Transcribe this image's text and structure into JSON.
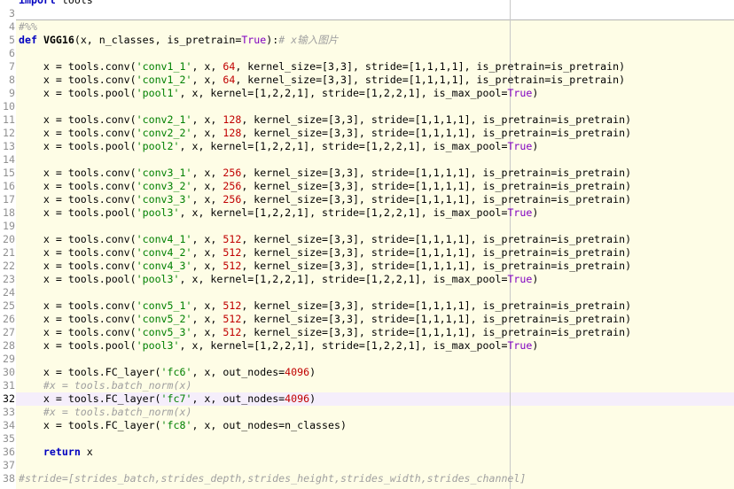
{
  "editor": {
    "current_line": "32",
    "lines": [
      {
        "n": "",
        "segments": [
          {
            "t": "import",
            "c": "kw"
          },
          {
            "t": " tools",
            "c": ""
          }
        ]
      },
      {
        "n": "3",
        "segments": []
      },
      {
        "n": "4",
        "segments": [
          {
            "t": "#%%",
            "c": "cmt"
          }
        ]
      },
      {
        "n": "5",
        "segments": [
          {
            "t": "def",
            "c": "kw"
          },
          {
            "t": " ",
            "c": ""
          },
          {
            "t": "VGG16",
            "c": "fn"
          },
          {
            "t": "(x, n_classes, is_pretrain=",
            "c": ""
          },
          {
            "t": "True",
            "c": "const"
          },
          {
            "t": "):",
            "c": ""
          },
          {
            "t": "# x输入图片",
            "c": "cmt"
          }
        ]
      },
      {
        "n": "6",
        "segments": []
      },
      {
        "n": "7",
        "segments": [
          {
            "t": "    x = tools.conv(",
            "c": ""
          },
          {
            "t": "'conv1_1'",
            "c": "str"
          },
          {
            "t": ", x, ",
            "c": ""
          },
          {
            "t": "64",
            "c": "num"
          },
          {
            "t": ", kernel_size=[3,3], stride=[1,1,1,1], is_pretrain=is_pretrain)",
            "c": ""
          }
        ]
      },
      {
        "n": "8",
        "segments": [
          {
            "t": "    x = tools.conv(",
            "c": ""
          },
          {
            "t": "'conv1_2'",
            "c": "str"
          },
          {
            "t": ", x, ",
            "c": ""
          },
          {
            "t": "64",
            "c": "num"
          },
          {
            "t": ", kernel_size=[3,3], stride=[1,1,1,1], is_pretrain=is_pretrain)",
            "c": ""
          }
        ]
      },
      {
        "n": "9",
        "segments": [
          {
            "t": "    x = tools.pool(",
            "c": ""
          },
          {
            "t": "'pool1'",
            "c": "str"
          },
          {
            "t": ", x, kernel=[1,2,2,1], stride=[1,2,2,1], is_max_pool=",
            "c": ""
          },
          {
            "t": "True",
            "c": "const"
          },
          {
            "t": ")",
            "c": ""
          }
        ]
      },
      {
        "n": "10",
        "segments": []
      },
      {
        "n": "11",
        "segments": [
          {
            "t": "    x = tools.conv(",
            "c": ""
          },
          {
            "t": "'conv2_1'",
            "c": "str"
          },
          {
            "t": ", x, ",
            "c": ""
          },
          {
            "t": "128",
            "c": "num"
          },
          {
            "t": ", kernel_size=[3,3], stride=[1,1,1,1], is_pretrain=is_pretrain)",
            "c": ""
          }
        ]
      },
      {
        "n": "12",
        "segments": [
          {
            "t": "    x = tools.conv(",
            "c": ""
          },
          {
            "t": "'conv2_2'",
            "c": "str"
          },
          {
            "t": ", x, ",
            "c": ""
          },
          {
            "t": "128",
            "c": "num"
          },
          {
            "t": ", kernel_size=[3,3], stride=[1,1,1,1], is_pretrain=is_pretrain)",
            "c": ""
          }
        ]
      },
      {
        "n": "13",
        "segments": [
          {
            "t": "    x = tools.pool(",
            "c": ""
          },
          {
            "t": "'pool2'",
            "c": "str"
          },
          {
            "t": ", x, kernel=[1,2,2,1], stride=[1,2,2,1], is_max_pool=",
            "c": ""
          },
          {
            "t": "True",
            "c": "const"
          },
          {
            "t": ")",
            "c": ""
          }
        ]
      },
      {
        "n": "14",
        "segments": []
      },
      {
        "n": "15",
        "segments": [
          {
            "t": "    x = tools.conv(",
            "c": ""
          },
          {
            "t": "'conv3_1'",
            "c": "str"
          },
          {
            "t": ", x, ",
            "c": ""
          },
          {
            "t": "256",
            "c": "num"
          },
          {
            "t": ", kernel_size=[3,3], stride=[1,1,1,1], is_pretrain=is_pretrain)",
            "c": ""
          }
        ]
      },
      {
        "n": "16",
        "segments": [
          {
            "t": "    x = tools.conv(",
            "c": ""
          },
          {
            "t": "'conv3_2'",
            "c": "str"
          },
          {
            "t": ", x, ",
            "c": ""
          },
          {
            "t": "256",
            "c": "num"
          },
          {
            "t": ", kernel_size=[3,3], stride=[1,1,1,1], is_pretrain=is_pretrain)",
            "c": ""
          }
        ]
      },
      {
        "n": "17",
        "segments": [
          {
            "t": "    x = tools.conv(",
            "c": ""
          },
          {
            "t": "'conv3_3'",
            "c": "str"
          },
          {
            "t": ", x, ",
            "c": ""
          },
          {
            "t": "256",
            "c": "num"
          },
          {
            "t": ", kernel_size=[3,3], stride=[1,1,1,1], is_pretrain=is_pretrain)",
            "c": ""
          }
        ]
      },
      {
        "n": "18",
        "segments": [
          {
            "t": "    x = tools.pool(",
            "c": ""
          },
          {
            "t": "'pool3'",
            "c": "str"
          },
          {
            "t": ", x, kernel=[1,2,2,1], stride=[1,2,2,1], is_max_pool=",
            "c": ""
          },
          {
            "t": "True",
            "c": "const"
          },
          {
            "t": ")",
            "c": ""
          }
        ]
      },
      {
        "n": "19",
        "segments": []
      },
      {
        "n": "20",
        "segments": [
          {
            "t": "    x = tools.conv(",
            "c": ""
          },
          {
            "t": "'conv4_1'",
            "c": "str"
          },
          {
            "t": ", x, ",
            "c": ""
          },
          {
            "t": "512",
            "c": "num"
          },
          {
            "t": ", kernel_size=[3,3], stride=[1,1,1,1], is_pretrain=is_pretrain)",
            "c": ""
          }
        ]
      },
      {
        "n": "21",
        "segments": [
          {
            "t": "    x = tools.conv(",
            "c": ""
          },
          {
            "t": "'conv4_2'",
            "c": "str"
          },
          {
            "t": ", x, ",
            "c": ""
          },
          {
            "t": "512",
            "c": "num"
          },
          {
            "t": ", kernel_size=[3,3], stride=[1,1,1,1], is_pretrain=is_pretrain)",
            "c": ""
          }
        ]
      },
      {
        "n": "22",
        "segments": [
          {
            "t": "    x = tools.conv(",
            "c": ""
          },
          {
            "t": "'conv4_3'",
            "c": "str"
          },
          {
            "t": ", x, ",
            "c": ""
          },
          {
            "t": "512",
            "c": "num"
          },
          {
            "t": ", kernel_size=[3,3], stride=[1,1,1,1], is_pretrain=is_pretrain)",
            "c": ""
          }
        ]
      },
      {
        "n": "23",
        "segments": [
          {
            "t": "    x = tools.pool(",
            "c": ""
          },
          {
            "t": "'pool3'",
            "c": "str"
          },
          {
            "t": ", x, kernel=[1,2,2,1], stride=[1,2,2,1], is_max_pool=",
            "c": ""
          },
          {
            "t": "True",
            "c": "const"
          },
          {
            "t": ")",
            "c": ""
          }
        ]
      },
      {
        "n": "24",
        "segments": []
      },
      {
        "n": "25",
        "segments": [
          {
            "t": "    x = tools.conv(",
            "c": ""
          },
          {
            "t": "'conv5_1'",
            "c": "str"
          },
          {
            "t": ", x, ",
            "c": ""
          },
          {
            "t": "512",
            "c": "num"
          },
          {
            "t": ", kernel_size=[3,3], stride=[1,1,1,1], is_pretrain=is_pretrain)",
            "c": ""
          }
        ]
      },
      {
        "n": "26",
        "segments": [
          {
            "t": "    x = tools.conv(",
            "c": ""
          },
          {
            "t": "'conv5_2'",
            "c": "str"
          },
          {
            "t": ", x, ",
            "c": ""
          },
          {
            "t": "512",
            "c": "num"
          },
          {
            "t": ", kernel_size=[3,3], stride=[1,1,1,1], is_pretrain=is_pretrain)",
            "c": ""
          }
        ]
      },
      {
        "n": "27",
        "segments": [
          {
            "t": "    x = tools.conv(",
            "c": ""
          },
          {
            "t": "'conv5_3'",
            "c": "str"
          },
          {
            "t": ", x, ",
            "c": ""
          },
          {
            "t": "512",
            "c": "num"
          },
          {
            "t": ", kernel_size=[3,3], stride=[1,1,1,1], is_pretrain=is_pretrain)",
            "c": ""
          }
        ]
      },
      {
        "n": "28",
        "segments": [
          {
            "t": "    x = tools.pool(",
            "c": ""
          },
          {
            "t": "'pool3'",
            "c": "str"
          },
          {
            "t": ", x, kernel=[1,2,2,1], stride=[1,2,2,1], is_max_pool=",
            "c": ""
          },
          {
            "t": "True",
            "c": "const"
          },
          {
            "t": ")",
            "c": ""
          }
        ]
      },
      {
        "n": "29",
        "segments": []
      },
      {
        "n": "30",
        "segments": [
          {
            "t": "    x = tools.FC_layer(",
            "c": ""
          },
          {
            "t": "'fc6'",
            "c": "str"
          },
          {
            "t": ", x, out_nodes=",
            "c": ""
          },
          {
            "t": "4096",
            "c": "num"
          },
          {
            "t": ")",
            "c": ""
          }
        ]
      },
      {
        "n": "31",
        "segments": [
          {
            "t": "    ",
            "c": ""
          },
          {
            "t": "#x = tools.batch_norm(x)",
            "c": "cmt"
          }
        ]
      },
      {
        "n": "32",
        "segments": [
          {
            "t": "    x = tools.FC_layer(",
            "c": ""
          },
          {
            "t": "'fc7'",
            "c": "str"
          },
          {
            "t": ", x, out_nodes=",
            "c": ""
          },
          {
            "t": "4096",
            "c": "num"
          },
          {
            "t": ")",
            "c": ""
          }
        ]
      },
      {
        "n": "33",
        "segments": [
          {
            "t": "    ",
            "c": ""
          },
          {
            "t": "#x = tools.batch_norm(x)",
            "c": "cmt"
          }
        ]
      },
      {
        "n": "34",
        "segments": [
          {
            "t": "    x = tools.FC_layer(",
            "c": ""
          },
          {
            "t": "'fc8'",
            "c": "str"
          },
          {
            "t": ", x, out_nodes=n_classes)",
            "c": ""
          }
        ]
      },
      {
        "n": "35",
        "segments": []
      },
      {
        "n": "36",
        "segments": [
          {
            "t": "    ",
            "c": ""
          },
          {
            "t": "return",
            "c": "kw"
          },
          {
            "t": " x",
            "c": ""
          }
        ]
      },
      {
        "n": "37",
        "segments": []
      },
      {
        "n": "38",
        "segments": [
          {
            "t": "#stride=[strides_batch,strides_depth,strides_height,strides_width,strides_channel]",
            "c": "cmt"
          }
        ]
      }
    ]
  }
}
